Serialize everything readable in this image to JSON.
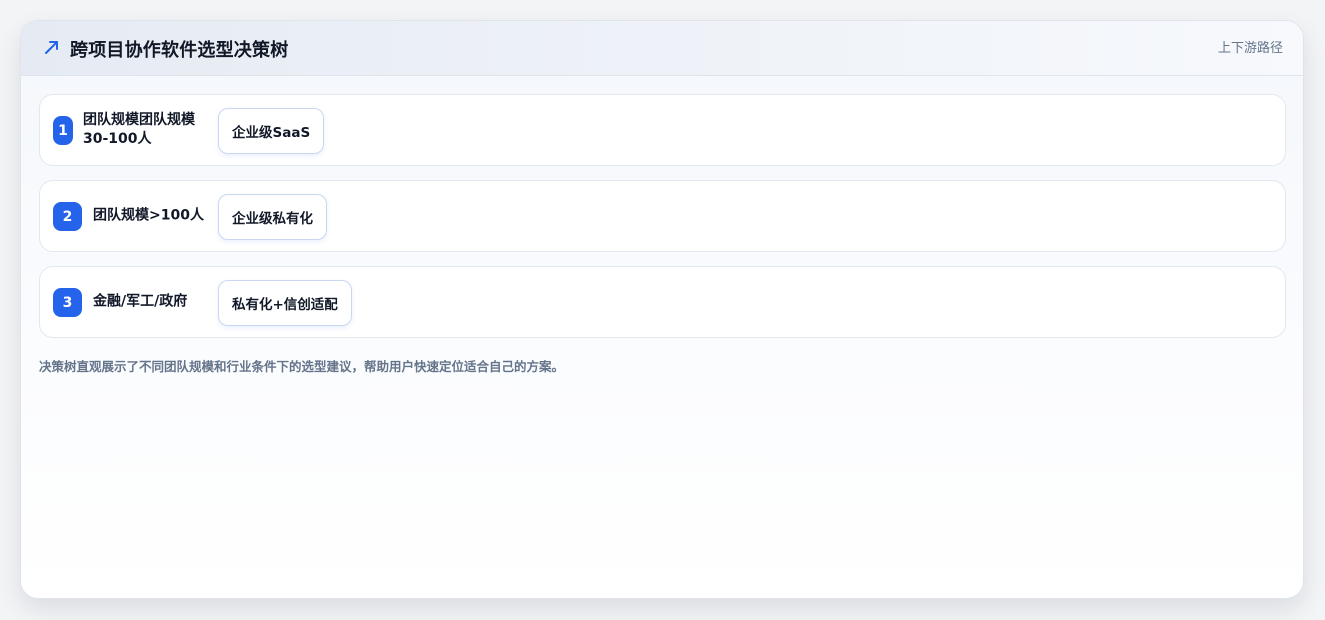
{
  "header": {
    "title": "跨项目协作软件选型决策树",
    "link": "上下游路径",
    "icon": "trend-arrow-icon",
    "accent": "#2563eb"
  },
  "rows": [
    {
      "number": "1",
      "condition_line1": "团队规模团队规模",
      "condition_line2": "30-100人",
      "recommendation": "企业级SaaS"
    },
    {
      "number": "2",
      "condition": "团队规模>100人",
      "recommendation": "企业级私有化"
    },
    {
      "number": "3",
      "condition": "金融/军工/政府",
      "recommendation": "私有化+信创适配"
    }
  ],
  "note": "决策树直观展示了不同团队规模和行业条件下的选型建议，帮助用户快速定位适合自己的方案。"
}
